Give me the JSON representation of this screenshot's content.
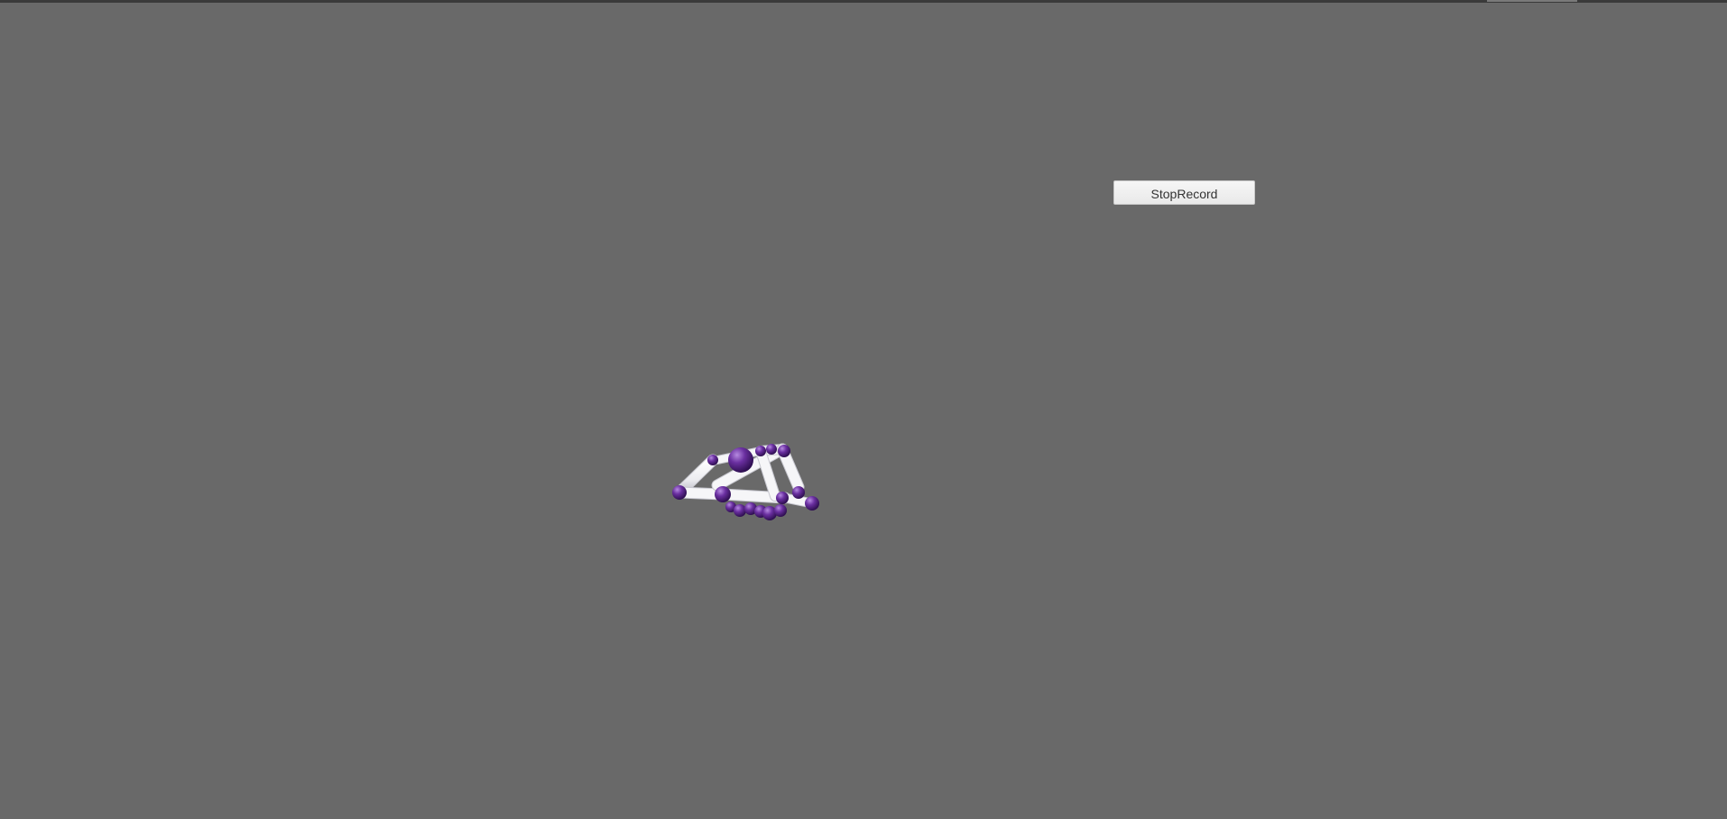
{
  "scene": {
    "background_color": "#696969",
    "model": {
      "name": "hand-skeleton",
      "joint_color": "#6a2fa0",
      "bone_color": "#f4f4f6"
    }
  },
  "controls": {
    "record_button_label": "StopRecord"
  }
}
